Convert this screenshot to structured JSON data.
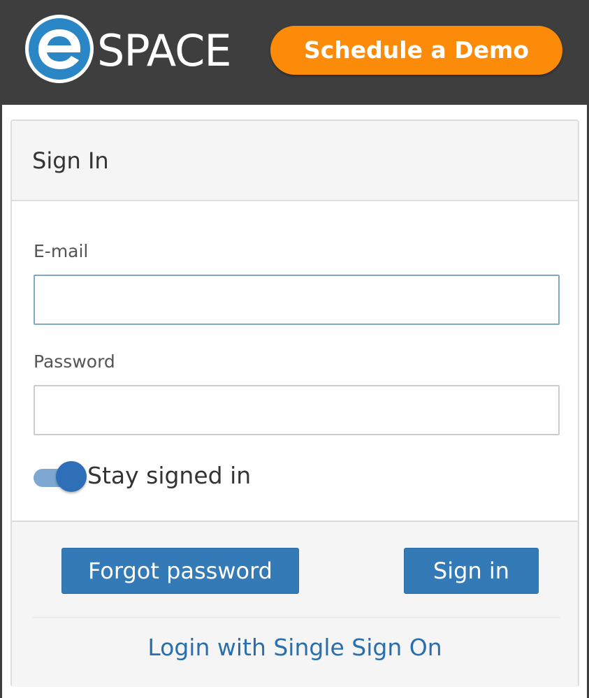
{
  "brand": {
    "logo_letter": "e",
    "logo_text": "SPACE",
    "logo_icon": "espace-logo-icon",
    "colors": {
      "header_bg": "#3e3e3e",
      "logo_blue": "#2b86c5",
      "cta_orange": "#fb8b09",
      "primary_blue": "#337ab7",
      "link_blue": "#2a6fad"
    }
  },
  "header": {
    "cta_label": "Schedule a Demo"
  },
  "signin_panel": {
    "title": "Sign In",
    "email": {
      "label": "E-mail",
      "value": "",
      "placeholder": ""
    },
    "password": {
      "label": "Password",
      "value": "",
      "placeholder": ""
    },
    "stay_signed_in": {
      "label": "Stay signed in",
      "checked": true
    },
    "buttons": {
      "forgot_password": "Forgot password",
      "sign_in": "Sign in"
    },
    "sso_link": "Login with Single Sign On"
  }
}
